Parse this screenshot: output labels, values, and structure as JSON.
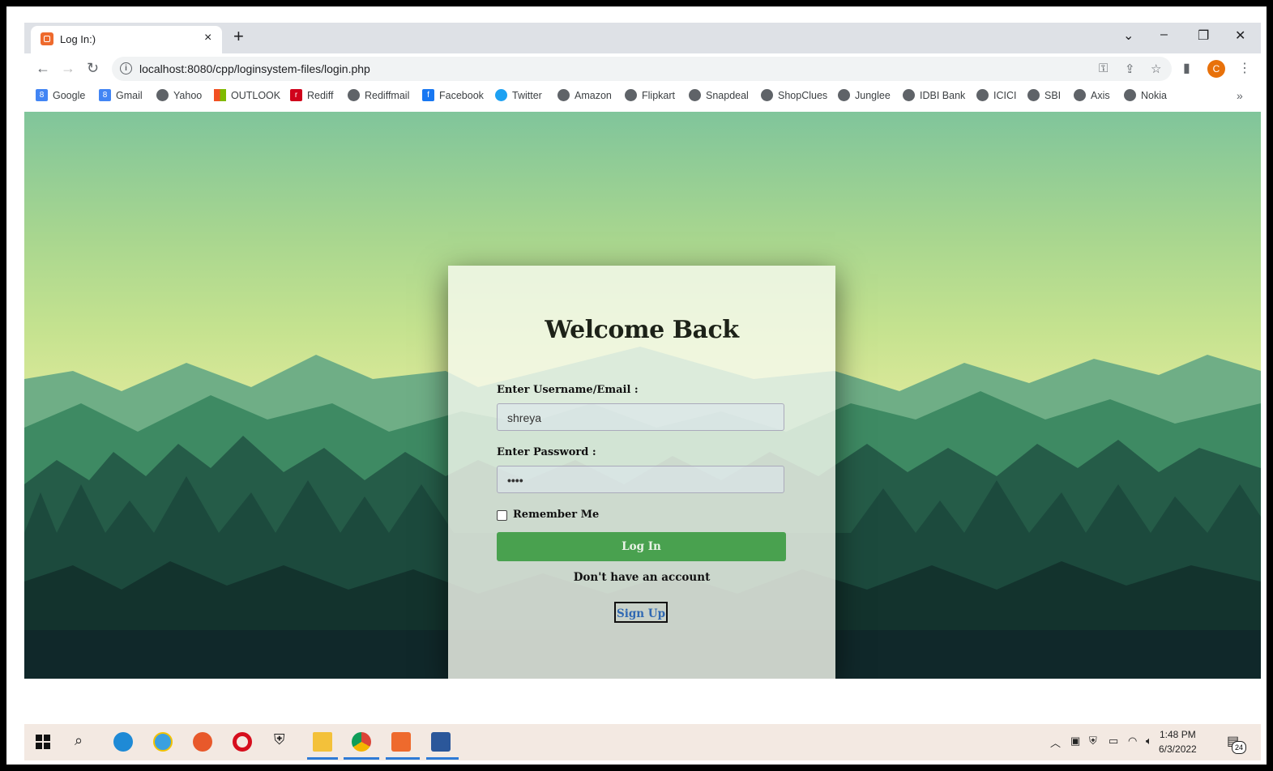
{
  "browser": {
    "tab_title": "Log In:)",
    "tab_close": "×",
    "new_tab": "+",
    "url": "localhost:8080/cpp/loginsystem-files/login.php",
    "profile_initial": "C",
    "window_controls": {
      "dropdown": "⌄",
      "minimize": "–",
      "restore": "❐",
      "close": "✕"
    }
  },
  "bookmarks": [
    {
      "label": "Google",
      "icon": "google-icon"
    },
    {
      "label": "Gmail",
      "icon": "google-icon"
    },
    {
      "label": "Yahoo",
      "icon": "globe-icon"
    },
    {
      "label": "OUTLOOK",
      "icon": "microsoft-icon"
    },
    {
      "label": "Rediff",
      "icon": "rediff-icon"
    },
    {
      "label": "Rediffmail",
      "icon": "globe-icon"
    },
    {
      "label": "Facebook",
      "icon": "facebook-icon"
    },
    {
      "label": "Twitter",
      "icon": "twitter-icon"
    },
    {
      "label": "Amazon",
      "icon": "globe-icon"
    },
    {
      "label": "Flipkart",
      "icon": "globe-icon"
    },
    {
      "label": "Snapdeal",
      "icon": "globe-icon"
    },
    {
      "label": "ShopClues",
      "icon": "globe-icon"
    },
    {
      "label": "Junglee",
      "icon": "globe-icon"
    },
    {
      "label": "IDBI Bank",
      "icon": "globe-icon"
    },
    {
      "label": "ICICI",
      "icon": "globe-icon"
    },
    {
      "label": "SBI",
      "icon": "globe-icon"
    },
    {
      "label": "Axis",
      "icon": "globe-icon"
    },
    {
      "label": "Nokia",
      "icon": "globe-icon"
    }
  ],
  "bookmarks_more": "»",
  "login": {
    "title": "Welcome Back",
    "username_label": "Enter Username/Email :",
    "username_value": "shreya",
    "password_label": "Enter Password :",
    "password_value": "••••",
    "remember_label": "Remember Me",
    "login_button": "Log In",
    "no_account_text": "Don't have an account",
    "signup_button": "Sign Up"
  },
  "taskbar": {
    "time": "1:48 PM",
    "date": "6/3/2022",
    "notification_count": "24"
  },
  "colors": {
    "login_button": "#49a14f",
    "signup_text": "#3069b3",
    "profile": "#e8710a",
    "taskbar": "#f3e9e2"
  }
}
